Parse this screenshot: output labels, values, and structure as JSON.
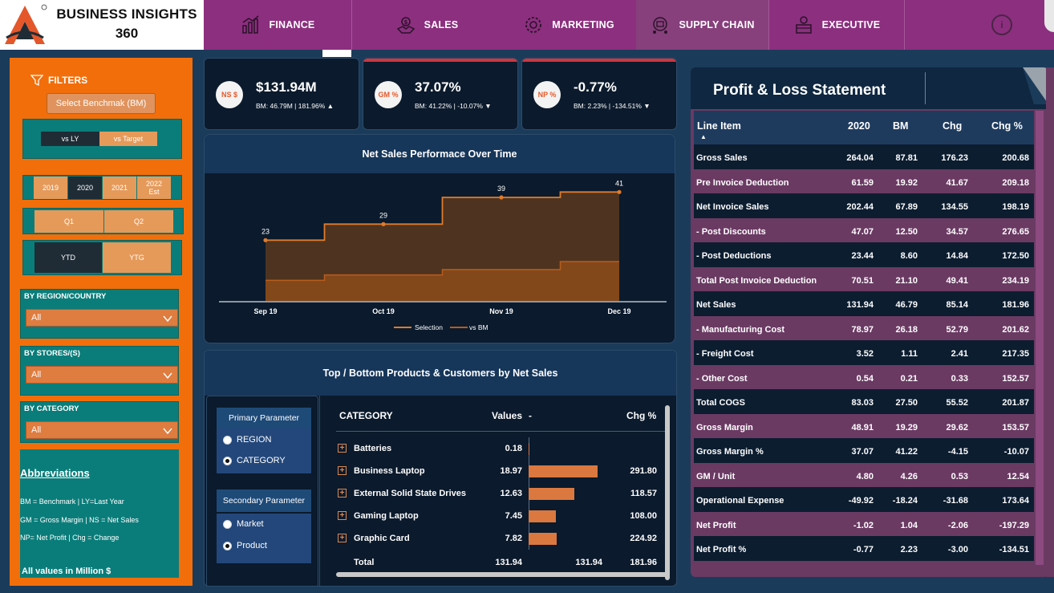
{
  "brand": {
    "line1": "BUSINESS INSIGHTS",
    "line2": "360"
  },
  "nav": {
    "tabs": [
      {
        "label": "FINANCE",
        "icon": "finance-chart-icon"
      },
      {
        "label": "SALES",
        "icon": "sales-handshake-icon"
      },
      {
        "label": "MARKETING",
        "icon": "marketing-gear-icon"
      },
      {
        "label": "SUPPLY CHAIN",
        "icon": "supply-chain-icon"
      },
      {
        "label": "EXECUTIVE",
        "icon": "executive-icon"
      }
    ],
    "info_icon": "info-icon"
  },
  "filters": {
    "title": "FILTERS",
    "benchmark_button": "Select Benchmak (BM)",
    "compare": {
      "options": [
        "vs LY",
        "vs Target"
      ],
      "selected": "vs LY"
    },
    "years": {
      "options": [
        "2019",
        "2020",
        "2021",
        "2022 Est"
      ],
      "selected": "2020"
    },
    "quarters": {
      "options": [
        "Q1",
        "Q2"
      ]
    },
    "period": {
      "options": [
        "YTD",
        "YTG"
      ],
      "selected": "YTD"
    },
    "region": {
      "label": "BY REGION/COUNTRY",
      "value": "All"
    },
    "stores": {
      "label": "BY STORES/(S)",
      "value": "All"
    },
    "category": {
      "label": "BY CATEGORY",
      "value": "All"
    }
  },
  "abbreviations": {
    "title": "Abbreviations",
    "lines": [
      "BM = Benchmark | LY=Last Year",
      "GM = Gross Margin | NS = Net Sales",
      "NP= Net Profit | Chg = Change"
    ],
    "footer": "All values in Million $"
  },
  "kpis": [
    {
      "badge": "NS $",
      "value": "$131.94M",
      "sub": "BM: 46.79M | 181.96% ▲"
    },
    {
      "badge": "GM %",
      "value": "37.07%",
      "sub": "BM: 41.22% | -10.07% ▼"
    },
    {
      "badge": "NP %",
      "value": "-0.77%",
      "sub": "BM: 2.23% | -134.51% ▼"
    }
  ],
  "chart_data": {
    "type": "area",
    "title": "Net Sales Performace Over Time",
    "categories": [
      "Sep 19",
      "Oct 19",
      "Nov 19",
      "Dec 19"
    ],
    "x_ticks": [
      "Sep 19",
      "Oct 19",
      "Nov 19",
      "Dec 19"
    ],
    "series": [
      {
        "name": "Selection",
        "values": [
          23,
          29,
          39,
          41
        ],
        "color": "#e07b2c"
      },
      {
        "name": "vs BM",
        "values": [
          8,
          10,
          12,
          15
        ],
        "color": "#b85c1e"
      }
    ],
    "data_labels": [
      "23",
      "29",
      "39",
      "41"
    ],
    "step": true,
    "ylim": [
      0,
      45
    ],
    "legend": "bottom-center",
    "grid": false
  },
  "products": {
    "title": "Top / Bottom Products & Customers by Net Sales",
    "primary": {
      "title": "Primary Parameter",
      "options": [
        "REGION",
        "CATEGORY"
      ],
      "selected": "CATEGORY"
    },
    "secondary": {
      "title": "Secondary Parameter",
      "options": [
        "Market",
        "Product"
      ],
      "selected": "Product"
    },
    "headers": {
      "col1": "CATEGORY",
      "col2": "Values",
      "col3": "-",
      "col4": "Chg %"
    },
    "rows": [
      {
        "name": "Batteries",
        "value": "0.18",
        "bar": 0.18,
        "chg": ""
      },
      {
        "name": "Business Laptop",
        "value": "18.97",
        "bar": 18.97,
        "chg": "291.80"
      },
      {
        "name": "External Solid State Drives",
        "value": "12.63",
        "bar": 12.63,
        "chg": "118.57"
      },
      {
        "name": "Gaming Laptop",
        "value": "7.45",
        "bar": 7.45,
        "chg": "108.00"
      },
      {
        "name": "Graphic Card",
        "value": "7.82",
        "bar": 7.82,
        "chg": "224.92"
      }
    ],
    "bar_max": 18.97,
    "total": {
      "label": "Total",
      "value": "131.94",
      "bar_total": "131.94",
      "chg": "181.96"
    }
  },
  "pl": {
    "title": "Profit & Loss Statement",
    "headers": [
      "Line Item",
      "2020",
      "BM",
      "Chg",
      "Chg %"
    ],
    "rows": [
      [
        "Gross Sales",
        "264.04",
        "87.81",
        "176.23",
        "200.68"
      ],
      [
        "Pre Invoice Deduction",
        "61.59",
        "19.92",
        "41.67",
        "209.18"
      ],
      [
        "Net Invoice Sales",
        "202.44",
        "67.89",
        "134.55",
        "198.19"
      ],
      [
        "- Post Discounts",
        "47.07",
        "12.50",
        "34.57",
        "276.65"
      ],
      [
        "- Post Deductions",
        "23.44",
        "8.60",
        "14.84",
        "172.50"
      ],
      [
        "Total Post Invoice Deduction",
        "70.51",
        "21.10",
        "49.41",
        "234.19"
      ],
      [
        "Net Sales",
        "131.94",
        "46.79",
        "85.14",
        "181.96"
      ],
      [
        " - Manufacturing Cost",
        "78.97",
        "26.18",
        "52.79",
        "201.62"
      ],
      [
        " - Freight Cost",
        "3.52",
        "1.11",
        "2.41",
        "217.35"
      ],
      [
        " - Other Cost",
        "0.54",
        "0.21",
        "0.33",
        "152.57"
      ],
      [
        "Total COGS",
        "83.03",
        "27.50",
        "55.52",
        "201.87"
      ],
      [
        "Gross Margin",
        "48.91",
        "19.29",
        "29.62",
        "153.57"
      ],
      [
        "Gross Margin %",
        "37.07",
        "41.22",
        "-4.15",
        "-10.07"
      ],
      [
        "GM / Unit",
        "4.80",
        "4.26",
        "0.53",
        "12.54"
      ],
      [
        "Operational Expense",
        "-49.92",
        "-18.24",
        "-31.68",
        "173.64"
      ],
      [
        "Net Profit",
        "-1.02",
        "1.04",
        "-2.06",
        "-197.29"
      ],
      [
        "Net Profit %",
        "-0.77",
        "2.23",
        "-3.00",
        "-134.51"
      ]
    ]
  }
}
